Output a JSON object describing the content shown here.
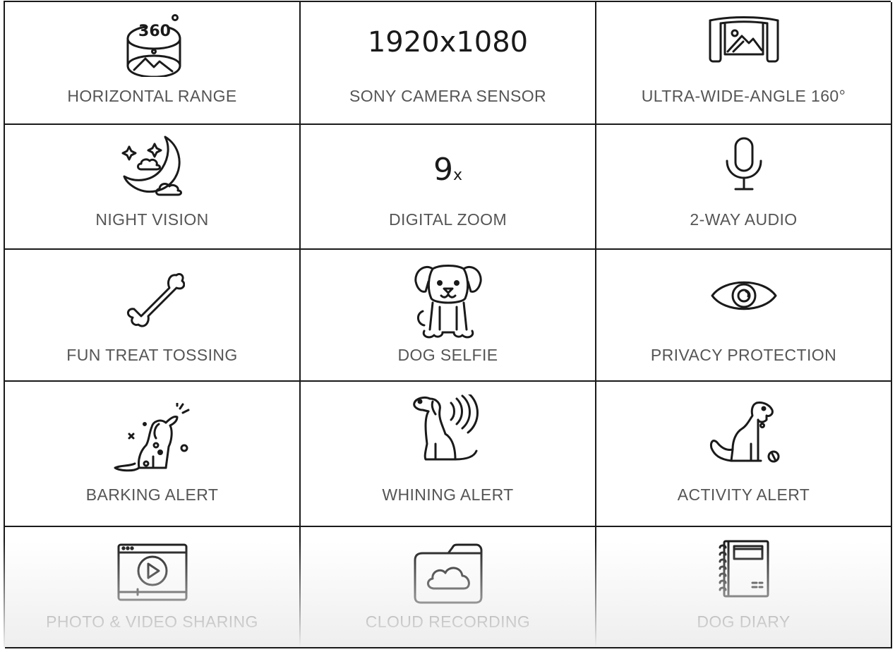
{
  "features": [
    {
      "label": "HORIZONTAL RANGE",
      "icon": "360-panorama-icon",
      "icon_text": "360"
    },
    {
      "label": "SONY CAMERA SENSOR",
      "icon_text": "1920x1080"
    },
    {
      "label": "ULTRA-WIDE-ANGLE 160°",
      "icon": "wide-angle-icon"
    },
    {
      "label": "NIGHT VISION",
      "icon": "moon-icon"
    },
    {
      "label": "DIGITAL ZOOM",
      "icon_text": "9",
      "icon_suffix": "x"
    },
    {
      "label": "2-WAY AUDIO",
      "icon": "microphone-icon"
    },
    {
      "label": "FUN TREAT TOSSING",
      "icon": "bone-icon"
    },
    {
      "label": "DOG SELFIE",
      "icon": "dog-face-icon"
    },
    {
      "label": "PRIVACY PROTECTION",
      "icon": "eye-icon"
    },
    {
      "label": "BARKING ALERT",
      "icon": "barking-dog-icon"
    },
    {
      "label": "WHINING ALERT",
      "icon": "whining-dog-icon"
    },
    {
      "label": "ACTIVITY ALERT",
      "icon": "sitting-dog-ball-icon"
    },
    {
      "label": "PHOTO & VIDEO SHARING",
      "icon": "video-player-icon"
    },
    {
      "label": "CLOUD RECORDING",
      "icon": "cloud-folder-icon"
    },
    {
      "label": "DOG DIARY",
      "icon": "notebook-icon"
    }
  ],
  "colors": {
    "border": "#1a1a1a",
    "label": "#555555",
    "icon": "#1a1a1a"
  }
}
